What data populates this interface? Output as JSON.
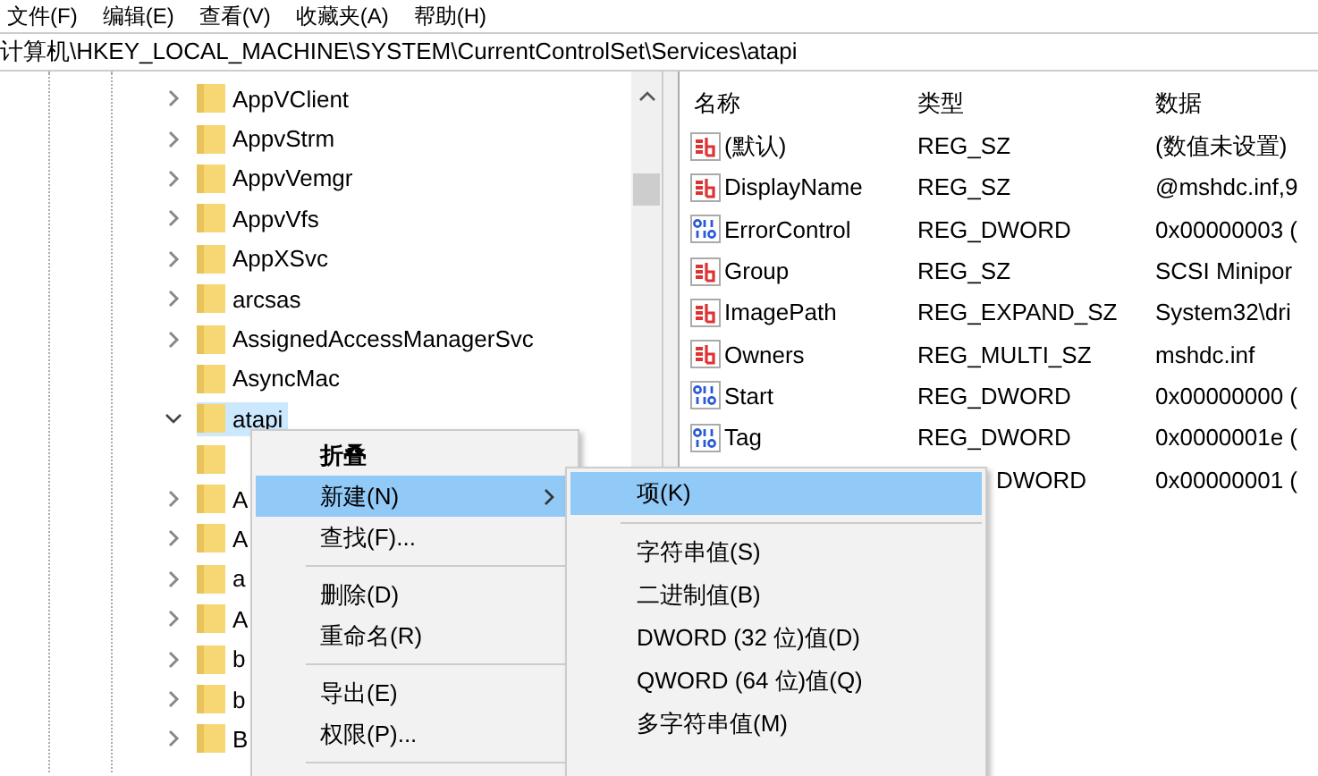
{
  "menu_bar": [
    "文件(F)",
    "编辑(E)",
    "查看(V)",
    "收藏夹(A)",
    "帮助(H)"
  ],
  "address": "计算机\\HKEY_LOCAL_MACHINE\\SYSTEM\\CurrentControlSet\\Services\\atapi",
  "tree": [
    {
      "label": "AppVClient",
      "expanded": false,
      "selected": false
    },
    {
      "label": "AppvStrm",
      "expanded": false,
      "selected": false
    },
    {
      "label": "AppvVemgr",
      "expanded": false,
      "selected": false
    },
    {
      "label": "AppvVfs",
      "expanded": false,
      "selected": false
    },
    {
      "label": "AppXSvc",
      "expanded": false,
      "selected": false
    },
    {
      "label": "arcsas",
      "expanded": false,
      "selected": false
    },
    {
      "label": "AssignedAccessManagerSvc",
      "expanded": false,
      "selected": false
    },
    {
      "label": "AsyncMac",
      "selected": false
    },
    {
      "label": "atapi",
      "expanded": true,
      "selected": true,
      "children": [
        {
          "selected": false
        }
      ]
    },
    {
      "label": "A",
      "expanded": false,
      "selected": false
    },
    {
      "label": "A",
      "expanded": false,
      "selected": false
    },
    {
      "label": "a",
      "expanded": false,
      "selected": false
    },
    {
      "label": "A",
      "expanded": false,
      "selected": false
    },
    {
      "label": "b",
      "expanded": false,
      "selected": false
    },
    {
      "label": "b",
      "expanded": false,
      "selected": false
    },
    {
      "label": "B",
      "expanded": false,
      "selected": false
    }
  ],
  "values": {
    "columns": [
      "名称",
      "类型",
      "数据"
    ],
    "rows": [
      {
        "kind": "string",
        "name": "(默认)",
        "type": "REG_SZ",
        "data": "(数值未设置)"
      },
      {
        "kind": "string",
        "name": "DisplayName",
        "type": "REG_SZ",
        "data": "@mshdc.inf,9"
      },
      {
        "kind": "binary",
        "name": "ErrorControl",
        "type": "REG_DWORD",
        "data": "0x00000003 ("
      },
      {
        "kind": "string",
        "name": "Group",
        "type": "REG_SZ",
        "data": "SCSI Minipor"
      },
      {
        "kind": "string",
        "name": "ImagePath",
        "type": "REG_EXPAND_SZ",
        "data": "System32\\dri"
      },
      {
        "kind": "string",
        "name": "Owners",
        "type": "REG_MULTI_SZ",
        "data": "mshdc.inf"
      },
      {
        "kind": "binary",
        "name": "Start",
        "type": "REG_DWORD",
        "data": "0x00000000 ("
      },
      {
        "kind": "binary",
        "name": "Tag",
        "type": "REG_DWORD",
        "data": "0x0000001e ("
      },
      {
        "kind": "hidden",
        "type": "DWORD",
        "data": "0x00000001 ("
      }
    ]
  },
  "context_menu": {
    "groups": [
      [
        {
          "label": "折叠",
          "default": true,
          "selected": false,
          "submenu": false
        },
        {
          "label": "新建(N)",
          "default": false,
          "selected": true,
          "submenu": true
        },
        {
          "label": "查找(F)...",
          "default": false,
          "selected": false,
          "submenu": false
        }
      ],
      [
        {
          "label": "删除(D)",
          "default": false,
          "selected": false,
          "submenu": false
        },
        {
          "label": "重命名(R)",
          "default": false,
          "selected": false,
          "submenu": false
        }
      ],
      [
        {
          "label": "导出(E)",
          "default": false,
          "selected": false,
          "submenu": false
        },
        {
          "label": "权限(P)...",
          "default": false,
          "selected": false,
          "submenu": false
        }
      ]
    ]
  },
  "submenu": {
    "groups": [
      [
        {
          "label": "项(K)",
          "selected": true
        }
      ],
      [
        {
          "label": "字符串值(S)",
          "selected": false
        },
        {
          "label": "二进制值(B)",
          "selected": false
        },
        {
          "label": "DWORD (32 位)值(D)",
          "selected": false
        },
        {
          "label": "QWORD (64 位)值(Q)",
          "selected": false
        },
        {
          "label": "多字符串值(M)",
          "selected": false
        }
      ]
    ]
  }
}
